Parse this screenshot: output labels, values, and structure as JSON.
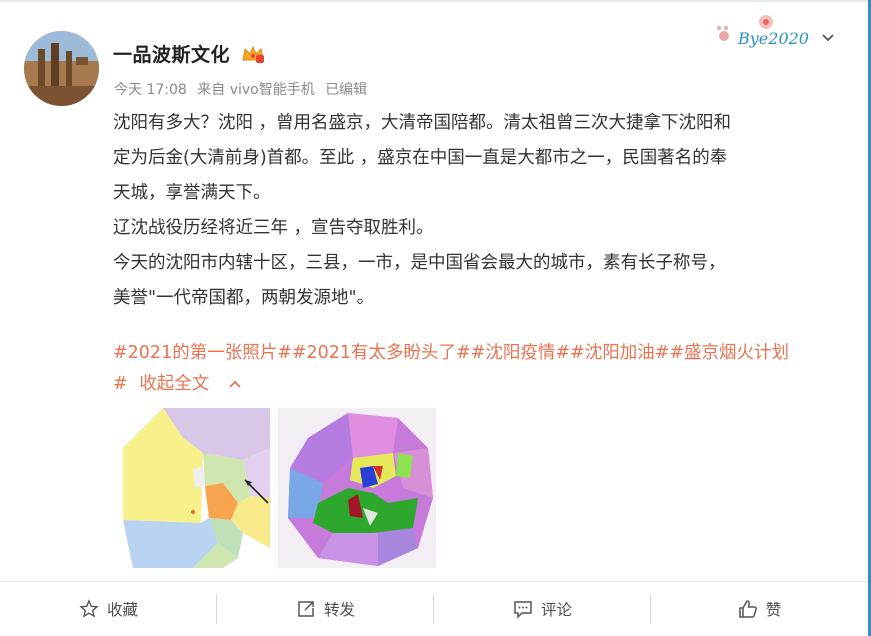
{
  "post": {
    "author": "一品波斯文化",
    "meta": {
      "time": "今天 17:08",
      "source": "来自 vivo智能手机",
      "edited": "已编辑"
    },
    "decoration_text": "Bye2020",
    "paragraphs": [
      "沈阳有多大？沈阳 ，曾用名盛京，大清帝国陪都。清太祖曾三次大捷拿下沈阳和",
      "定为后金(大清前身)首都。至此 ，盛京在中国一直是大都市之一，民国著名的奉",
      "天城，享誉满天下。",
      "辽沈战役历经将近三年 ，宣告夺取胜利。",
      "今天的沈阳市内辖十区，三县，一市，是中国省会最大的城市，素有长子称号，",
      "美誉\"一代帝国都，两朝发源地\"。"
    ],
    "tags_line": "#2021的第一张照片##2021有太多盼头了##沈阳疫情##沈阳加油##盛京烟火计划",
    "tag_hash": "#",
    "collapse_label": "收起全文"
  },
  "actions": {
    "favorite": "收藏",
    "repost": "转发",
    "comment": "评论",
    "like": "赞"
  },
  "colors": {
    "link": "#eb7350",
    "text": "#333333",
    "meta": "#8a8a8a",
    "accent_frame": "#3a8ac6"
  },
  "icons": [
    "chevron-down-icon",
    "vip-crown-icon",
    "star-icon",
    "repost-icon",
    "comment-icon",
    "thumbs-up-icon",
    "collapse-chevron-icon"
  ]
}
